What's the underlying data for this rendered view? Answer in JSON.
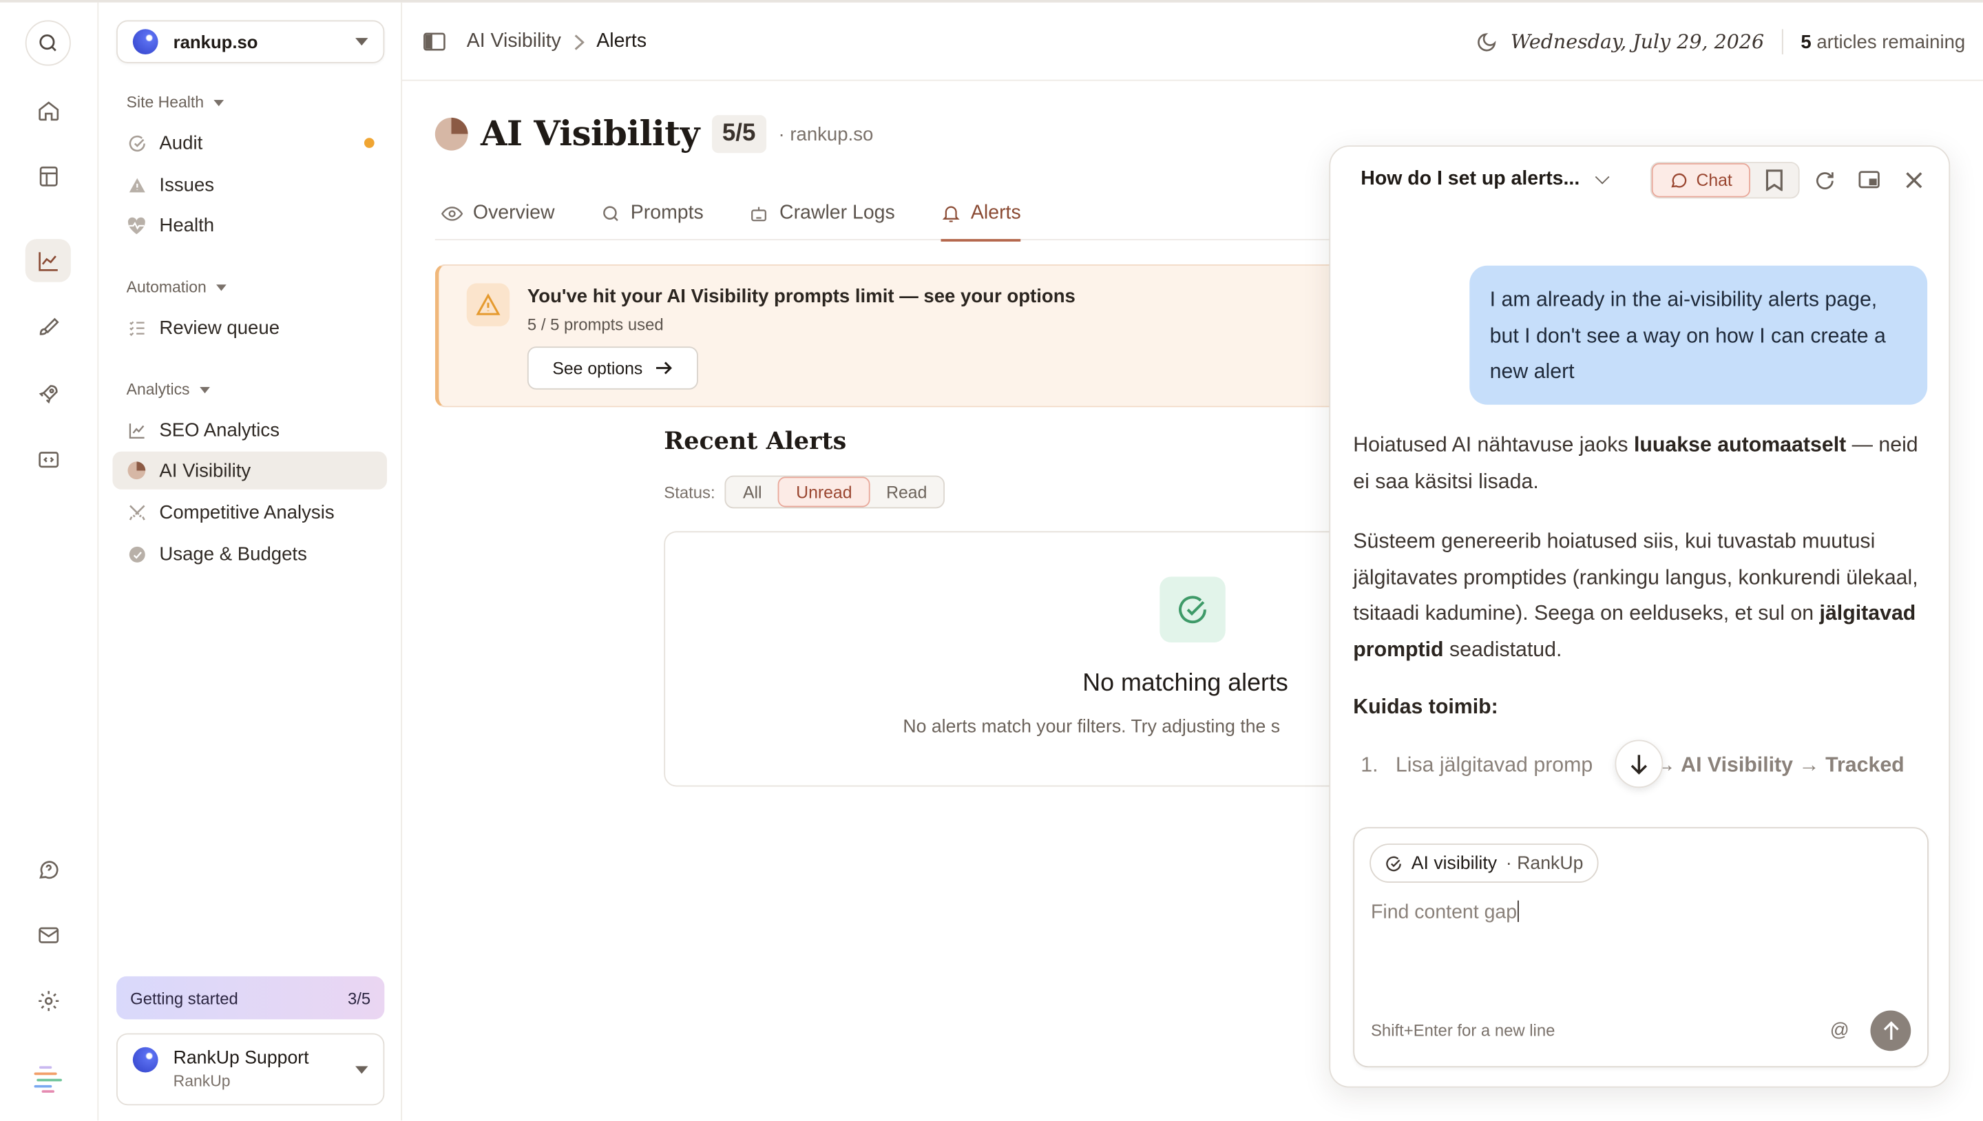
{
  "sidebar": {
    "org": "rankup.so",
    "sections": [
      {
        "label": "Site Health",
        "items": [
          {
            "label": "Audit",
            "icon": "audit-icon",
            "dot": true
          },
          {
            "label": "Issues",
            "icon": "warning-icon"
          },
          {
            "label": "Health",
            "icon": "heartbeat-icon"
          }
        ]
      },
      {
        "label": "Automation",
        "items": [
          {
            "label": "Review queue",
            "icon": "list-icon"
          }
        ]
      },
      {
        "label": "Analytics",
        "items": [
          {
            "label": "SEO Analytics",
            "icon": "line-chart-icon"
          },
          {
            "label": "AI Visibility",
            "icon": "pie-chart-icon",
            "active": true
          },
          {
            "label": "Competitive Analysis",
            "icon": "swords-icon"
          },
          {
            "label": "Usage & Budgets",
            "icon": "gauge-icon"
          }
        ]
      }
    ],
    "getting_started": {
      "label": "Getting started",
      "progress": "3/5"
    },
    "support": {
      "name": "RankUp Support",
      "org": "RankUp"
    }
  },
  "header": {
    "breadcrumb": [
      "AI Visibility",
      "Alerts"
    ],
    "date": "Wednesday, July 29, 2026",
    "articles_count": "5",
    "articles_label": "articles remaining"
  },
  "page": {
    "title": "AI Visibility",
    "badge": "5/5",
    "domain": "· rankup.so",
    "tabs": [
      {
        "label": "Overview",
        "icon": "eye-icon"
      },
      {
        "label": "Prompts",
        "icon": "search-icon"
      },
      {
        "label": "Crawler Logs",
        "icon": "robot-icon"
      },
      {
        "label": "Alerts",
        "icon": "bell-icon",
        "active": true
      }
    ],
    "limit_banner": {
      "title": "You've hit your AI Visibility prompts limit — see your options",
      "subtitle": "5 / 5 prompts used",
      "button": "See options"
    },
    "recent_alerts": {
      "title": "Recent Alerts",
      "status_label": "Status:",
      "filters": [
        "All",
        "Unread",
        "Read"
      ],
      "selected_filter": "Unread",
      "empty_title": "No matching alerts",
      "empty_text": "No alerts match your filters. Try adjusting the s"
    }
  },
  "chat": {
    "title": "How do I set up alerts...",
    "chat_button": "Chat",
    "user_message": "I am already in the ai-visibility alerts page, but I don't see a way on how I can create a new alert",
    "answer": {
      "p1_a": "Hoiatused AI nähtavuse jaoks ",
      "p1_b": "luuakse automaatselt",
      "p1_c": " — neid ei saa käsitsi lisada.",
      "p2_a": "Süsteem genereerib hoiatused siis, kui tuvastab muutusi jälgitavates promptides (rankingu langus, konkurendi ülekaal, tsitaadi kadumine). Seega on eelduseks, et sul on ",
      "p2_b": "jälgitavad promptid",
      "p2_c": " seadistatud.",
      "heading": "Kuidas toimib:",
      "step_num": "1.",
      "step_text": "Lisa jälgitavad promp",
      "step_path": "→ AI Visibility → Tracked"
    },
    "composer": {
      "context_label": "AI visibility",
      "context_sub": "· RankUp",
      "typed": "Find content gap",
      "hint": "Shift+Enter for a new line",
      "at": "@"
    }
  }
}
